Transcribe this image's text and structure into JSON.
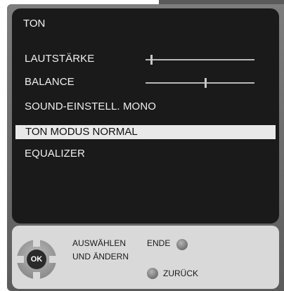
{
  "menu": {
    "title": "TON",
    "items": [
      {
        "label": "LAUTSTÄRKE",
        "slider_level": 0.05
      },
      {
        "label": "BALANCE",
        "slider_level": 0.55
      },
      {
        "label": "SOUND-EINSTELL. MONO"
      },
      {
        "label": "TON MODUS NORMAL",
        "selected": true
      },
      {
        "label": "EQUALIZER"
      }
    ]
  },
  "footer": {
    "ok_label": "OK",
    "select_line1": "AUSWÄHLEN",
    "select_line2": "UND ÄNDERN",
    "exit_label": "ENDE",
    "back_label": "ZURÜCK"
  }
}
